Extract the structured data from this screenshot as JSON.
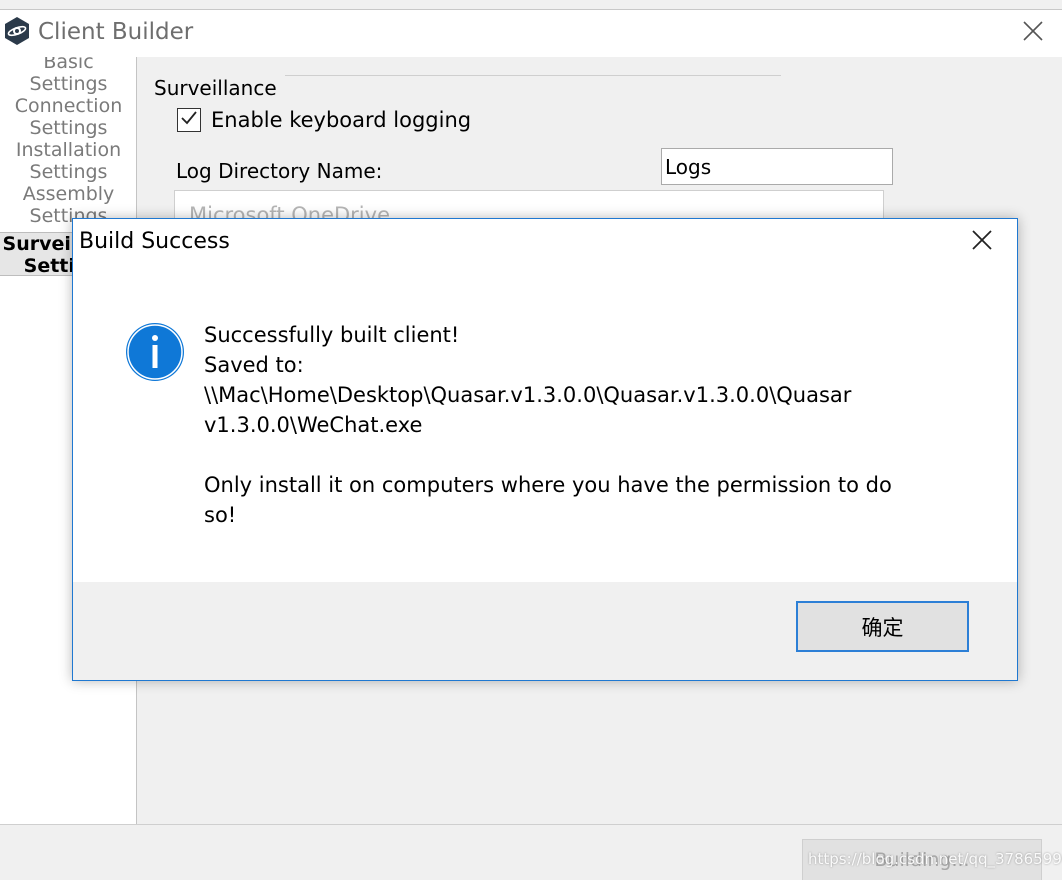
{
  "window": {
    "title": "Client Builder",
    "icon": "quasar-logo-icon",
    "close_icon": "close-icon"
  },
  "sidebar": {
    "items": [
      {
        "line1": "Basic",
        "line2": "Settings",
        "active": false
      },
      {
        "line1": "Connection",
        "line2": "Settings",
        "active": false
      },
      {
        "line1": "Installation",
        "line2": "Settings",
        "active": false
      },
      {
        "line1": "Assembly",
        "line2": "Settings",
        "active": false
      },
      {
        "line1": "Surveillance",
        "line2": "Settings",
        "active": true
      }
    ]
  },
  "surveillance": {
    "section_title": "Surveillance",
    "keylog_label": "Enable keyboard logging",
    "keylog_checked": true,
    "log_dir_label": "Log Directory Name:",
    "log_dir_value": "Logs",
    "folder_item": "Microsoft OneDrive"
  },
  "bottom": {
    "build_label": "Building..."
  },
  "dialog": {
    "title": "Build Success",
    "icon": "info-icon",
    "message": {
      "line1": "Successfully built client!",
      "line2": "Saved to:",
      "line3": "\\\\Mac\\Home\\Desktop\\Quasar.v1.3.0.0\\Quasar.v1.3.0.0\\Quasar",
      "line4": "v1.3.0.0\\WeChat.exe",
      "line5": "Only install it on computers where you have the permission to do",
      "line6": "so!"
    },
    "ok_label": "确定"
  },
  "watermark": {
    "text": "https://blog.csdn.net/qq_37865996"
  },
  "colors": {
    "accent": "#1f78d1",
    "info_icon": "#0f78d7",
    "background": "#f0f0f0"
  }
}
